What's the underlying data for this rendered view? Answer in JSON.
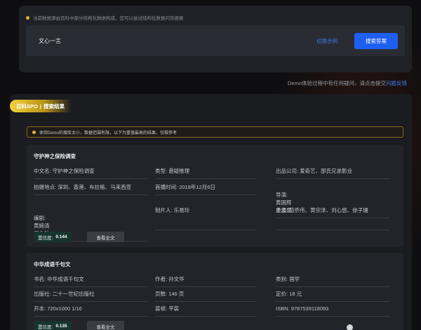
{
  "search_panel": {
    "tip": "当前数据源由百科中部分结构化数据构成，您可以尝试结构化数据问答搜索",
    "query": "文心一言",
    "switch_label": "切换示例",
    "search_button": "搜索答案"
  },
  "feedback": {
    "text": "Demo体验过程中有任何疑问，请点击提交",
    "link": "问题反馈"
  },
  "results": {
    "tag_prefix": "百科SPO",
    "tag_divider": "|",
    "tag_label": "搜索结果",
    "notice": "体验Demo的搜库太小，数据范围有限，以下为重值最高的结果，仅做参考",
    "score_label": "置信度:",
    "view_label": "查看全文",
    "cards": [
      {
        "title": "守护神之保险调查",
        "fields": [
          {
            "key": "中文名:",
            "val": "守护神之保险调查"
          },
          {
            "key": "类型:",
            "val": "悬疑推理"
          },
          {
            "key": "出品公司:",
            "val": "爱奇艺、邵氏兄弟影业"
          },
          {
            "key": "拍摄地点:",
            "val": "深圳、香港、布拉格、马来西亚"
          },
          {
            "key": "首播时间:",
            "val": "2018年12月6日"
          },
          {
            "key": "导演:",
            "val": "黄国辉\n巢志豪"
          },
          {
            "key": "编剧:",
            "val": "黄婉清\n何永航"
          },
          {
            "key": "制片人:",
            "val": "乐易玲"
          },
          {
            "key": "主演:",
            "val": "苗侨伟、黄宗泽、刘心悠、徐子珊"
          }
        ],
        "score": "0.144"
      },
      {
        "title": "中华成语千句文",
        "fields": [
          {
            "key": "书名:",
            "val": "中华成语千句文"
          },
          {
            "key": "作者:",
            "val": "孙文华"
          },
          {
            "key": "类别:",
            "val": "国学"
          },
          {
            "key": "出版社:",
            "val": "二十一世纪出版社"
          },
          {
            "key": "页数:",
            "val": "146 页"
          },
          {
            "key": "定价:",
            "val": "18 元"
          },
          {
            "key": "开本:",
            "val": "720x1000 1/16"
          },
          {
            "key": "装帧:",
            "val": "平装"
          },
          {
            "key": "ISBN:",
            "val": "9787539118093"
          }
        ],
        "score": "0.135"
      }
    ]
  },
  "colors": {
    "accent_blue": "#1f5ff0",
    "link_blue": "#3c7be8",
    "tag_yellow": "#f4d23a",
    "notice_border": "#8a6a22",
    "score_bg": "#17352e"
  }
}
